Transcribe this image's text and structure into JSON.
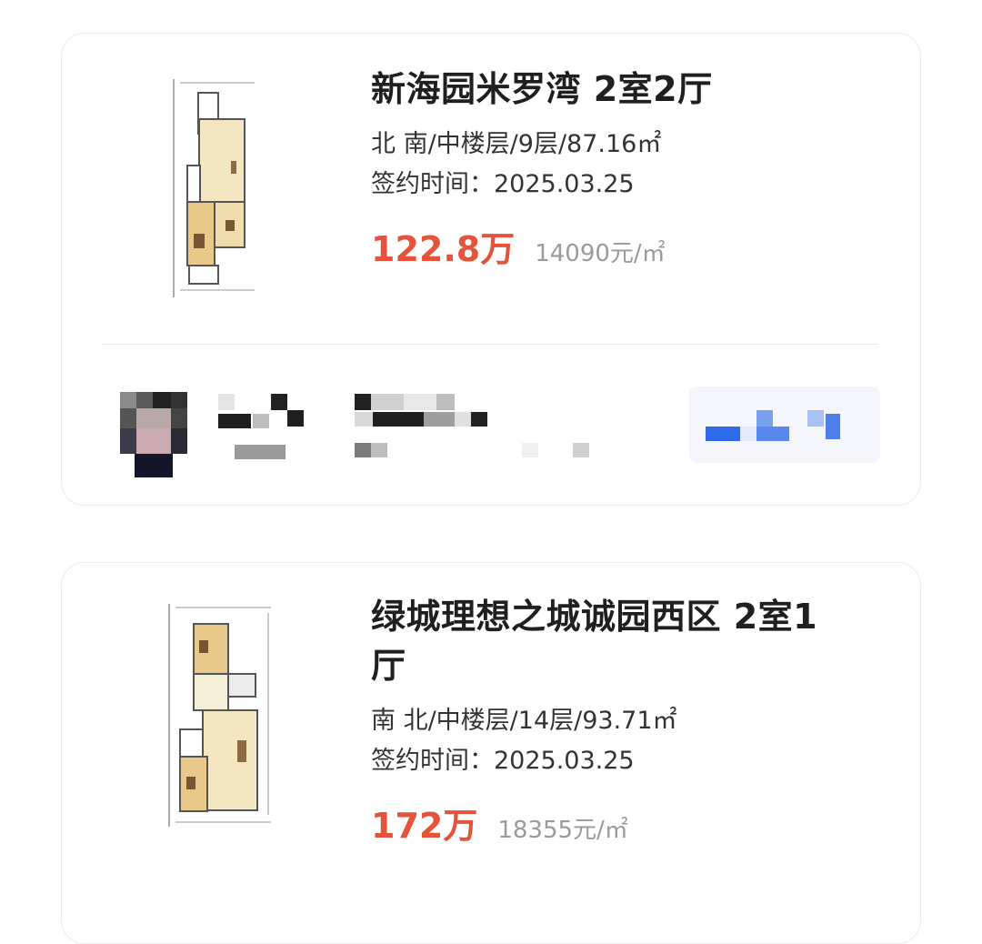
{
  "listings": [
    {
      "title": "新海园米罗湾 2室2厅",
      "detail": "北 南/中楼层/9层/87.16㎡",
      "contract_date": "签约时间：2025.03.25",
      "total_price": "122.8万",
      "unit_price": "14090元/㎡"
    },
    {
      "title_line1": "绿城理想之城诚园西区 2室1",
      "title_line2": "厅",
      "detail": "南 北/中楼层/14层/93.71㎡",
      "contract_date": "签约时间：2025.03.25",
      "total_price": "172万",
      "unit_price": "18355元/㎡"
    }
  ],
  "colors": {
    "price": "#e4533a",
    "muted": "#9b9b9b",
    "card_border": "#ececec",
    "accent_blue": "#2f6be8"
  },
  "icons": {
    "agent_avatar": "avatar-pixelated",
    "contact_button": "chat-icon-pixelated"
  }
}
